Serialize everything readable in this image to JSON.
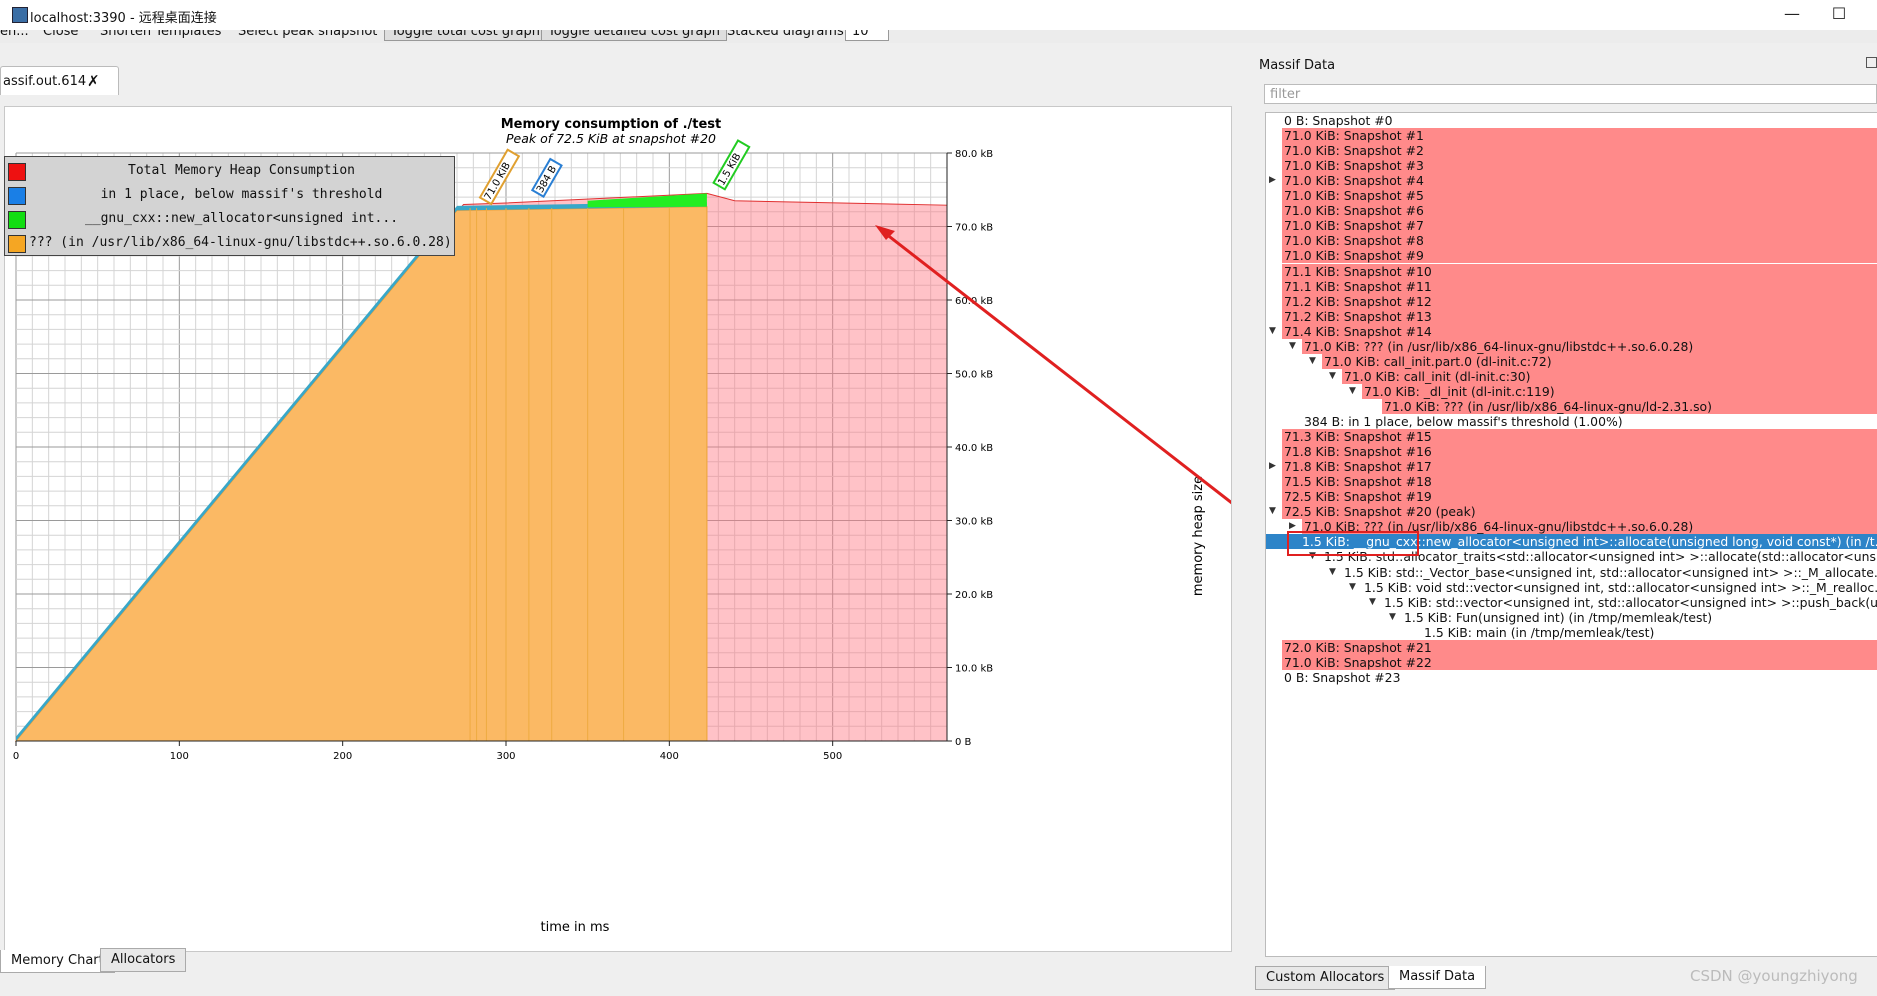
{
  "window": {
    "title": "localhost:3390 - 远程桌面连接",
    "minimize": "—",
    "maximize": "☐"
  },
  "toolbar": {
    "items": [
      "en...",
      "Close",
      "Shorten Templates",
      "Select peak snapshot"
    ],
    "buttons": [
      "Toggle total cost graph",
      "Toggle detailed cost graph"
    ],
    "stacked_label": "Stacked diagrams:",
    "stacked_value": "10"
  },
  "file_tab": {
    "label": "assif.out.614"
  },
  "chart_data": {
    "type": "area",
    "title": "Memory consumption of ./test",
    "subtitle": "Peak of 72.5 KiB at snapshot #20",
    "xlabel": "time in ms",
    "ylabel": "memory heap size",
    "x_ticks": [
      "0",
      "100",
      "200",
      "300",
      "400",
      "500"
    ],
    "y_ticks": [
      "0 B",
      "10.0 kB",
      "20.0 kB",
      "30.0 kB",
      "40.0 kB",
      "50.0 kB",
      "60.0 kB",
      "70.0 kB",
      "80.0 kB"
    ],
    "xlim": [
      0,
      570
    ],
    "ylim": [
      0,
      80
    ],
    "total_series": {
      "x": [
        0,
        274,
        300,
        423,
        440,
        570
      ],
      "y": [
        0,
        73.0,
        73.2,
        74.5,
        73.5,
        72.9
      ]
    },
    "orange_series": {
      "x": [
        0,
        270,
        423
      ],
      "y": [
        0,
        72.2,
        72.7
      ]
    },
    "green_series": {
      "x": [
        350,
        423
      ],
      "y": [
        73.5,
        74.5
      ]
    },
    "annotations": [
      {
        "text": "71.0 KiB",
        "x": 290,
        "y": 73.5,
        "color": "#e0a030"
      },
      {
        "text": "384 B",
        "x": 322,
        "y": 74.5,
        "color": "#2a7fd4"
      },
      {
        "text": "1.5 KiB",
        "x": 433,
        "y": 75.5,
        "color": "#22cc22"
      }
    ],
    "legend": [
      {
        "label": "Total Memory Heap Consumption",
        "color": "#ee1111"
      },
      {
        "label": "in 1 place, below massif's threshold",
        "color": "#1a7fe6"
      },
      {
        "label": "__gnu_cxx::new_allocator<unsigned int...",
        "color": "#11dd11"
      },
      {
        "label": "??? (in /usr/lib/x86_64-linux-gnu/libstdc++.so.6.0.28)",
        "color": "#f5a623"
      }
    ]
  },
  "right_panel": {
    "title": "Massif Data",
    "filter_placeholder": "filter",
    "tree": [
      {
        "text": "0 B: Snapshot #0",
        "level": 0,
        "style": "plain"
      },
      {
        "text": "71.0 KiB: Snapshot #1",
        "level": 0,
        "style": "snap"
      },
      {
        "text": "71.0 KiB: Snapshot #2",
        "level": 0,
        "style": "snap"
      },
      {
        "text": "71.0 KiB: Snapshot #3",
        "level": 0,
        "style": "snap"
      },
      {
        "text": "71.0 KiB: Snapshot #4",
        "level": 0,
        "style": "snap",
        "arrow": "right"
      },
      {
        "text": "71.0 KiB: Snapshot #5",
        "level": 0,
        "style": "snap"
      },
      {
        "text": "71.0 KiB: Snapshot #6",
        "level": 0,
        "style": "snap"
      },
      {
        "text": "71.0 KiB: Snapshot #7",
        "level": 0,
        "style": "snap"
      },
      {
        "text": "71.0 KiB: Snapshot #8",
        "level": 0,
        "style": "snap"
      },
      {
        "text": "71.0 KiB: Snapshot #9",
        "level": 0,
        "style": "snap"
      },
      {
        "text": "71.1 KiB: Snapshot #10",
        "level": 0,
        "style": "snap"
      },
      {
        "text": "71.1 KiB: Snapshot #11",
        "level": 0,
        "style": "snap"
      },
      {
        "text": "71.2 KiB: Snapshot #12",
        "level": 0,
        "style": "snap"
      },
      {
        "text": "71.2 KiB: Snapshot #13",
        "level": 0,
        "style": "snap"
      },
      {
        "text": "71.4 KiB: Snapshot #14",
        "level": 0,
        "style": "snap",
        "arrow": "down"
      },
      {
        "text": "71.0 KiB: ??? (in /usr/lib/x86_64-linux-gnu/libstdc++.so.6.0.28)",
        "level": 1,
        "style": "snap",
        "arrow": "down"
      },
      {
        "text": "71.0 KiB: call_init.part.0 (dl-init.c:72)",
        "level": 2,
        "style": "snap",
        "arrow": "down"
      },
      {
        "text": "71.0 KiB: call_init (dl-init.c:30)",
        "level": 3,
        "style": "snap",
        "arrow": "down"
      },
      {
        "text": "71.0 KiB: _dl_init (dl-init.c:119)",
        "level": 4,
        "style": "snap",
        "arrow": "down"
      },
      {
        "text": "71.0 KiB: ??? (in /usr/lib/x86_64-linux-gnu/ld-2.31.so)",
        "level": 5,
        "style": "snap"
      },
      {
        "text": "384 B: in 1 place, below massif's threshold (1.00%)",
        "level": 1,
        "style": "plain"
      },
      {
        "text": "71.3 KiB: Snapshot #15",
        "level": 0,
        "style": "snap"
      },
      {
        "text": "71.8 KiB: Snapshot #16",
        "level": 0,
        "style": "snap"
      },
      {
        "text": "71.8 KiB: Snapshot #17",
        "level": 0,
        "style": "snap",
        "arrow": "right"
      },
      {
        "text": "71.5 KiB: Snapshot #18",
        "level": 0,
        "style": "snap"
      },
      {
        "text": "72.5 KiB: Snapshot #19",
        "level": 0,
        "style": "snap"
      },
      {
        "text": "72.5 KiB: Snapshot #20 (peak)",
        "level": 0,
        "style": "snap",
        "arrow": "down"
      },
      {
        "text": "71.0 KiB: ??? (in /usr/lib/x86_64-linux-gnu/libstdc++.so.6.0.28)",
        "level": 1,
        "style": "snap",
        "arrow": "right"
      },
      {
        "text": "1.5 KiB: __gnu_cxx::new_allocator<unsigned int>::allocate(unsigned long, void const*) (in /t...",
        "level": 1,
        "style": "sel",
        "arrow": "down"
      },
      {
        "text": "1.5 KiB: std::allocator_traits<std::allocator<unsigned int> >::allocate(std::allocator<unsi...",
        "level": 2,
        "style": "plain",
        "arrow": "down"
      },
      {
        "text": "1.5 KiB: std::_Vector_base<unsigned int, std::allocator<unsigned int> >::_M_allocate...",
        "level": 3,
        "style": "plain",
        "arrow": "down"
      },
      {
        "text": "1.5 KiB: void std::vector<unsigned int, std::allocator<unsigned int> >::_M_realloc...",
        "level": 4,
        "style": "plain",
        "arrow": "down"
      },
      {
        "text": "1.5 KiB: std::vector<unsigned int, std::allocator<unsigned int> >::push_back(u...",
        "level": 5,
        "style": "plain",
        "arrow": "down"
      },
      {
        "text": "1.5 KiB: Fun(unsigned int) (in /tmp/memleak/test)",
        "level": 6,
        "style": "plain",
        "arrow": "down"
      },
      {
        "text": "1.5 KiB: main (in /tmp/memleak/test)",
        "level": 7,
        "style": "plain"
      },
      {
        "text": "72.0 KiB: Snapshot #21",
        "level": 0,
        "style": "snap"
      },
      {
        "text": "71.0 KiB: Snapshot #22",
        "level": 0,
        "style": "snap"
      },
      {
        "text": "0 B: Snapshot #23",
        "level": 0,
        "style": "plain"
      }
    ]
  },
  "bottom_tabs_left": [
    "Memory Chart",
    "Allocators"
  ],
  "bottom_tabs_right": [
    "Custom Allocators",
    "Massif Data"
  ],
  "watermark": "CSDN @youngzhiyong"
}
